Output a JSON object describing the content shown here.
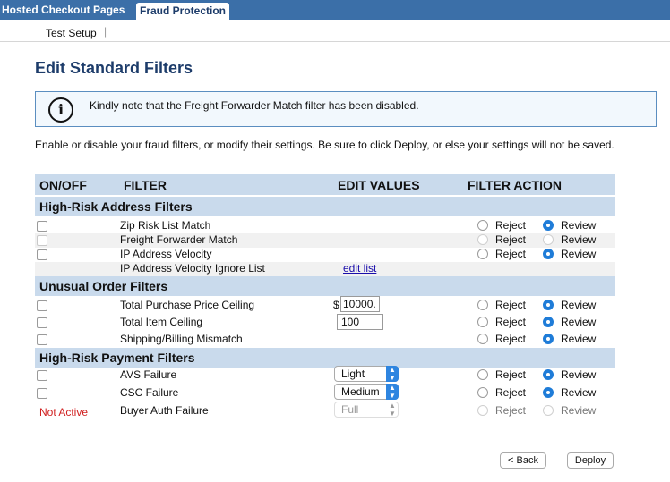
{
  "tabs": [
    "Hosted Checkout Pages",
    "Fraud Protection"
  ],
  "subnav": {
    "item": "Test Setup",
    "sep": "|"
  },
  "page_title": "Edit Standard Filters",
  "notice": {
    "icon": "i",
    "text": "Kindly note that the Freight Forwarder Match filter has been disabled."
  },
  "intro": "Enable or disable your fraud filters, or modify their settings. Be sure to click Deploy, or else your settings will not be saved.",
  "table": {
    "headers": {
      "onoff": "ON/OFF",
      "filter": "FILTER",
      "edit": "EDIT VALUES",
      "action": "FILTER ACTION"
    },
    "sections": {
      "address": "High-Risk Address Filters",
      "order": "Unusual Order Filters",
      "payment": "High-Risk Payment Filters"
    },
    "radio_labels": {
      "reject": "Reject",
      "review": "Review"
    },
    "rows": {
      "zip": "Zip Risk List Match",
      "freight": "Freight Forwarder Match",
      "ip": "IP Address Velocity",
      "ip_ignore": "IP Address Velocity Ignore List",
      "ip_ignore_link": "edit list",
      "price": "Total Purchase Price Ceiling",
      "price_currency": "$",
      "price_value": "10000.",
      "item": "Total Item Ceiling",
      "item_value": "100",
      "ship": "Shipping/Billing Mismatch",
      "avs": "AVS Failure",
      "avs_value": "Light",
      "csc": "CSC Failure",
      "csc_value": "Medium",
      "buyer": "Buyer Auth Failure",
      "buyer_value": "Full",
      "buyer_status": "Not Active"
    }
  },
  "buttons": {
    "back": "< Back",
    "deploy": "Deploy"
  },
  "colors": {
    "topbar": "#3b6fa8",
    "title": "#1d3c6a",
    "header_bg": "#c9daec",
    "radio_selected": "#1f7cd8",
    "not_active": "#d02020"
  }
}
